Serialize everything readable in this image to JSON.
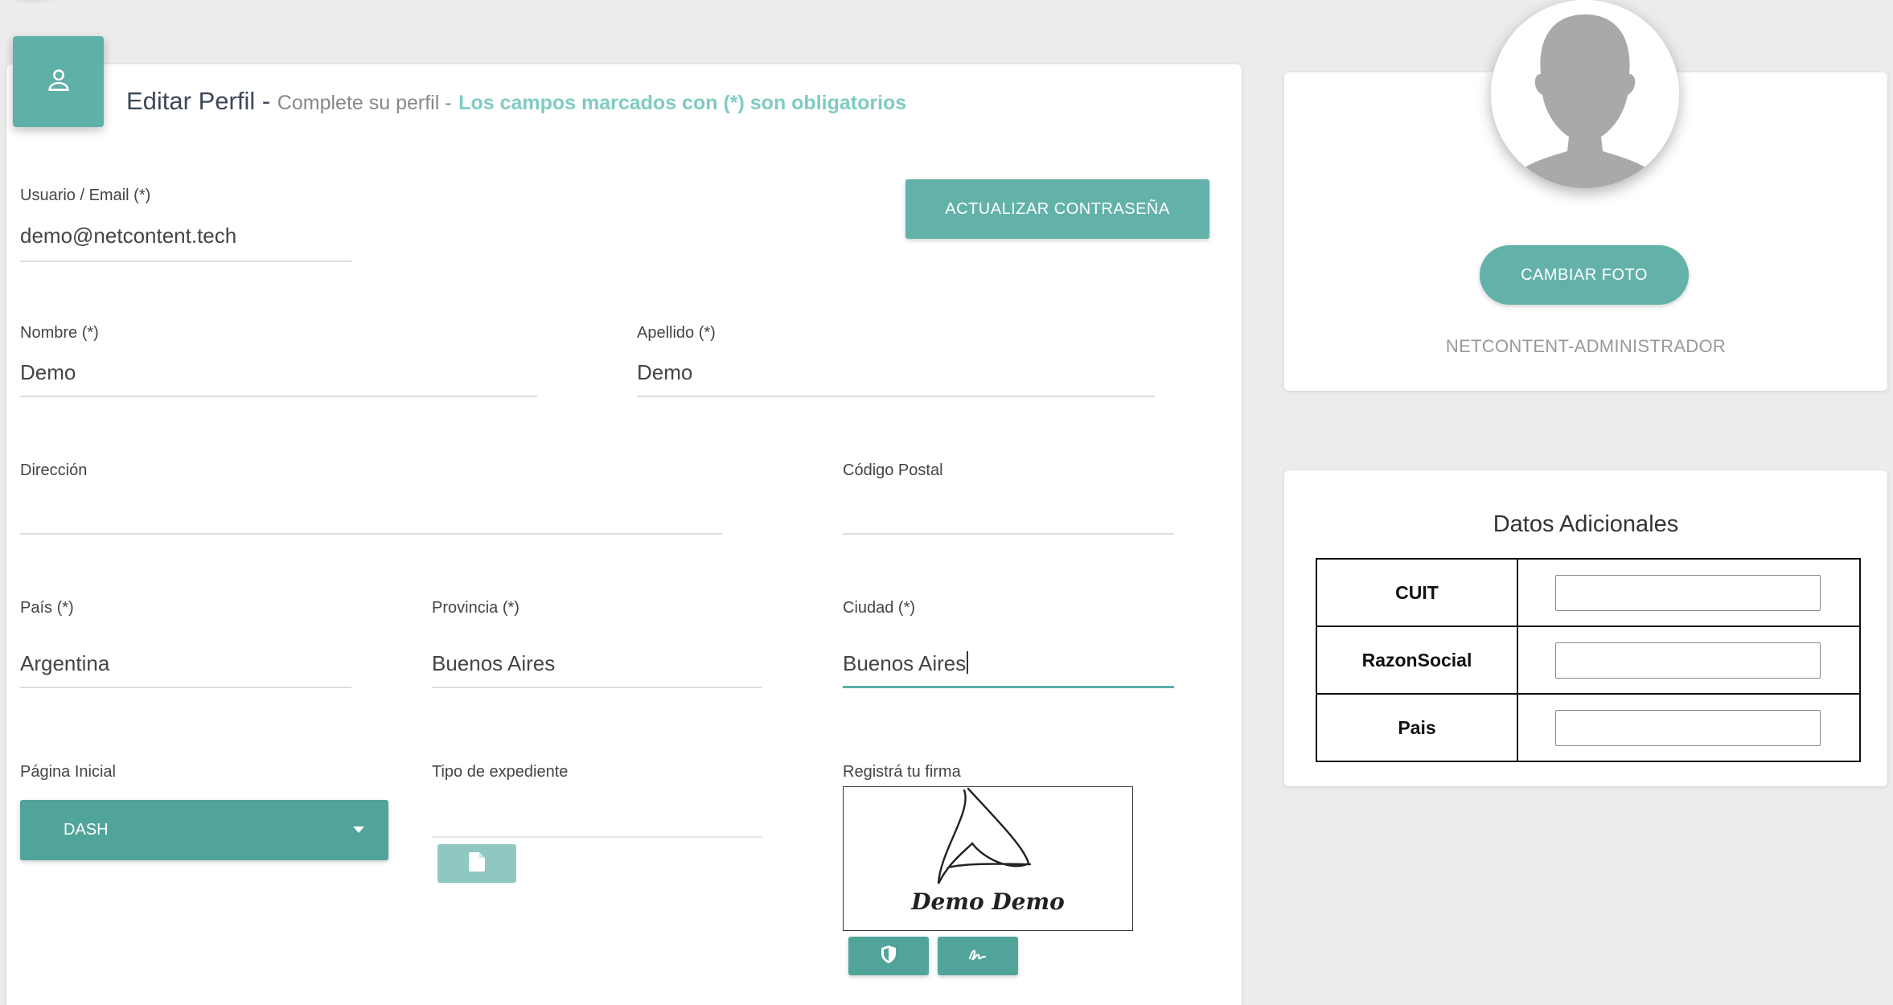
{
  "header": {
    "title": "Editar Perfil -",
    "subtitle": "Complete su perfil -",
    "required_note": "Los campos marcados con (*) son obligatorios",
    "icon": "person-icon"
  },
  "form": {
    "usuario": {
      "label": "Usuario / Email (*)",
      "value": "demo@netcontent.tech"
    },
    "update_password_label": "ACTUALIZAR CONTRASEÑA",
    "nombre": {
      "label": "Nombre (*)",
      "value": "Demo"
    },
    "apellido": {
      "label": "Apellido (*)",
      "value": "Demo"
    },
    "direccion": {
      "label": "Dirección",
      "value": ""
    },
    "codigo_postal": {
      "label": "Código Postal",
      "value": ""
    },
    "pais": {
      "label": "País (*)",
      "value": "Argentina"
    },
    "provincia": {
      "label": "Provincia (*)",
      "value": "Buenos Aires"
    },
    "ciudad": {
      "label": "Ciudad (*)",
      "value": "Buenos Aires"
    },
    "pagina_inicial": {
      "label": "Página Inicial",
      "selected": "DASH"
    },
    "tipo_expediente": {
      "label": "Tipo de expediente",
      "value": ""
    },
    "firma": {
      "label": "Registrá tu firma",
      "signature_text": "Demo Demo"
    }
  },
  "profile": {
    "change_photo_label": "CAMBIAR FOTO",
    "role": "NETCONTENT-ADMINISTRADOR"
  },
  "extra": {
    "title": "Datos Adicionales",
    "rows": [
      {
        "key": "CUIT",
        "value": ""
      },
      {
        "key": "RazonSocial",
        "value": ""
      },
      {
        "key": "Pais",
        "value": ""
      }
    ]
  },
  "colors": {
    "accent": "#5fb0a8",
    "accent_dark": "#51a49a",
    "accent_light": "#7fcbc2"
  }
}
